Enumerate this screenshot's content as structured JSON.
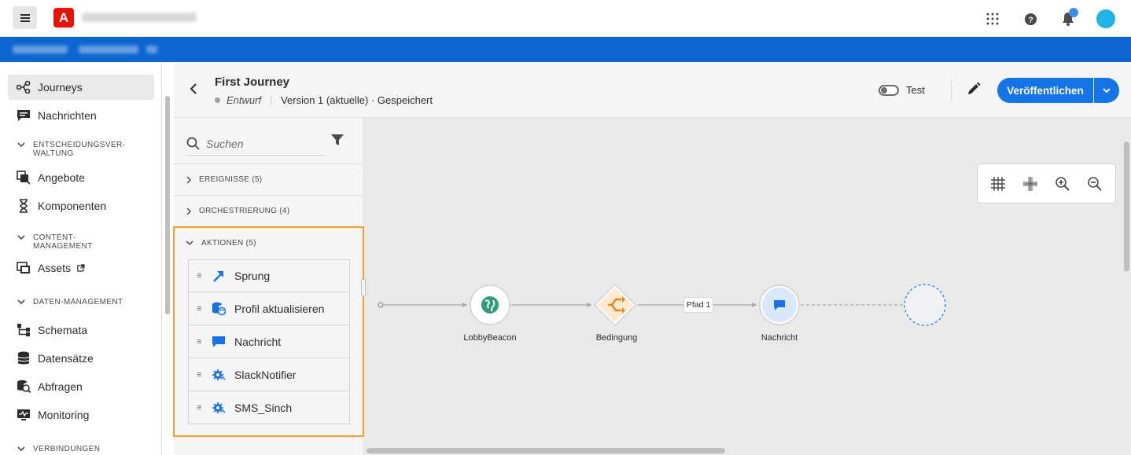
{
  "topbar": {
    "logo_letter": "A",
    "icons": [
      "apps-grid-icon",
      "help-icon",
      "bell-icon",
      "avatar"
    ]
  },
  "nav": {
    "items": [
      {
        "label": "Journeys",
        "icon": "journeys-icon",
        "active": true
      },
      {
        "label": "Nachrichten",
        "icon": "message-icon"
      },
      {
        "section": "ENTSCHEIDUNGSVER-\nWALTUNG"
      },
      {
        "label": "Angebote",
        "icon": "offers-icon"
      },
      {
        "label": "Komponenten",
        "icon": "components-icon"
      },
      {
        "section": "CONTENT-\nMANAGEMENT"
      },
      {
        "label": "Assets",
        "icon": "assets-icon",
        "external": true
      },
      {
        "section": "DATEN-MANAGEMENT"
      },
      {
        "label": "Schemata",
        "icon": "schema-icon"
      },
      {
        "label": "Datensätze",
        "icon": "datasets-icon"
      },
      {
        "label": "Abfragen",
        "icon": "queries-icon"
      },
      {
        "label": "Monitoring",
        "icon": "monitoring-icon"
      },
      {
        "section": "VERBINDUNGEN"
      }
    ],
    "section_1_line1": "ENTSCHEIDUNGSVER-",
    "section_1_line2": "WALTUNG",
    "section_2_line1": "CONTENT-",
    "section_2_line2": "MANAGEMENT",
    "section_3": "DATEN-MANAGEMENT",
    "section_4": "VERBINDUNGEN",
    "label_journeys": "Journeys",
    "label_nachrichten": "Nachrichten",
    "label_angebote": "Angebote",
    "label_komponenten": "Komponenten",
    "label_assets": "Assets",
    "label_schemata": "Schemata",
    "label_datensaetze": "Datensätze",
    "label_abfragen": "Abfragen",
    "label_monitoring": "Monitoring"
  },
  "journey": {
    "title": "First Journey",
    "status": "Entwurf",
    "version": "Version 1 (aktuelle) · Gespeichert",
    "test_label": "Test",
    "test_enabled": false,
    "publish_label": "Veröffentlichen"
  },
  "palette": {
    "search_placeholder": "Suchen",
    "categories": [
      {
        "label": "EREIGNISSE (5)",
        "expanded": false
      },
      {
        "label": "ORCHESTRIERUNG (4)",
        "expanded": false
      },
      {
        "label": "AKTIONEN (5)",
        "expanded": true
      }
    ],
    "cat_events": "EREIGNISSE (5)",
    "cat_orch": "ORCHESTRIERUNG (4)",
    "cat_actions": "AKTIONEN (5)",
    "actions": [
      {
        "label": "Sprung",
        "icon": "jump-icon"
      },
      {
        "label": "Profil aktualisieren",
        "icon": "update-profile-icon"
      },
      {
        "label": "Nachricht",
        "icon": "message-icon"
      },
      {
        "label": "SlackNotifier",
        "icon": "custom-action-icon"
      },
      {
        "label": "SMS_Sinch",
        "icon": "custom-action-icon"
      }
    ]
  },
  "canvas": {
    "tools": [
      "grid-icon",
      "snap-icon",
      "zoom-in-icon",
      "zoom-out-icon"
    ],
    "nodes": [
      {
        "label": "LobbyBeacon",
        "type": "event"
      },
      {
        "label": "Bedingung",
        "type": "condition"
      },
      {
        "label": "Nachricht",
        "type": "message"
      }
    ],
    "path_label": "Pfad 1"
  },
  "colors": {
    "accent": "#1473e6",
    "highlight": "#f59e2a",
    "event": "#2d9d78",
    "condition": "#e68619"
  }
}
